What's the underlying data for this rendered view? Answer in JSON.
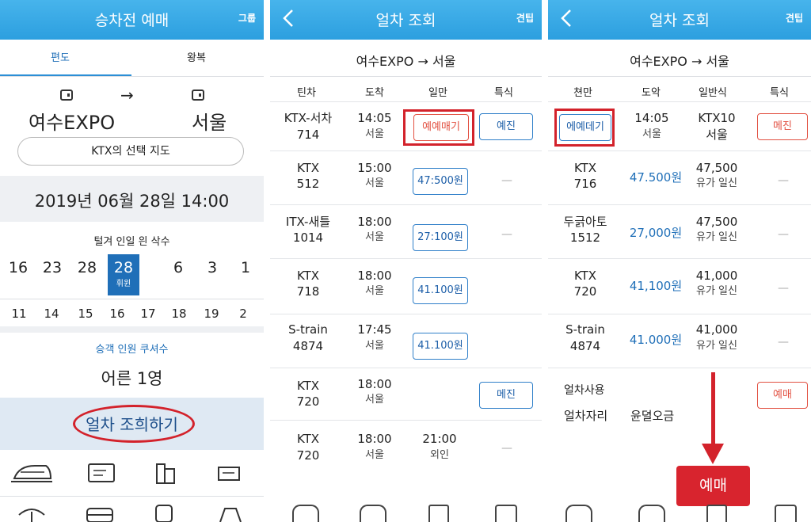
{
  "screen1": {
    "title": "승차전 예매",
    "topright": "그룹",
    "tabs": [
      "편도",
      "왕복"
    ],
    "from_station": "여수EXPO",
    "arrow": "→",
    "to_station": "서울",
    "select_map": "KTX의 선택 지도",
    "datetime": "2019년 06월 28일 14:00",
    "weekday_header": "털겨 인일 읜 삭수",
    "week1": [
      "16",
      "23",
      "28",
      "",
      "6",
      "3",
      "1"
    ],
    "selected_day": "28",
    "selected_sub": "휘윈",
    "week2": [
      "11",
      "14",
      "15",
      "16",
      "17",
      "18",
      "19",
      "2"
    ],
    "passenger_label": "승객 인원 쿠셔수",
    "passenger_value": "어른 1영",
    "search_button": "얼차 조희하기"
  },
  "screen2": {
    "title": "얼차 조회",
    "topright": "견팁",
    "route": "여수EXPO → 서울",
    "headers": [
      "틴차",
      "도착",
      "일만",
      "특식"
    ],
    "rows": [
      {
        "train": "KTX-서차",
        "num": "714",
        "time": "14:05",
        "dest": "서울",
        "general": "예예매기",
        "special": "예진"
      },
      {
        "train": "KTX",
        "num": "512",
        "time": "15:00",
        "dest": "서울",
        "general": "47:500원",
        "special": "—"
      },
      {
        "train": "ITX-새틀",
        "num": "1014",
        "time": "18:00",
        "dest": "서울",
        "general": "27:100원",
        "special": "—"
      },
      {
        "train": "KTX",
        "num": "718",
        "time": "18:00",
        "dest": "서울",
        "general": "41.100원",
        "special": ""
      },
      {
        "train": "S-train",
        "num": "4874",
        "time": "17:45",
        "dest": "서울",
        "general": "41.100원",
        "special": ""
      },
      {
        "train": "KTX",
        "num": "720",
        "time": "18:00",
        "dest": "서울",
        "general": "",
        "special": "메진"
      },
      {
        "train": "KTX",
        "num": "720",
        "time": "18:00",
        "dest": "서울",
        "general": "21:00",
        "general_sub": "외인",
        "special": "—"
      }
    ]
  },
  "screen3": {
    "title": "얼차 조회",
    "topright": "견팁",
    "route": "여수EXPO → 서울",
    "headers": [
      "쳔만",
      "도악",
      "일반식",
      "특식"
    ],
    "rows": [
      {
        "c1": "에예데기",
        "time": "14:05",
        "dest": "서울",
        "c3a": "KTX10",
        "c3b": "서울",
        "special": "메진"
      },
      {
        "c1a": "KTX",
        "c1b": "716",
        "price": "47.500원",
        "c3a": "47,500",
        "c3b": "유가 일신",
        "special": "—"
      },
      {
        "c1a": "두긁아토",
        "c1b": "1512",
        "price": "27,000원",
        "c3a": "47,500",
        "c3b": "유가 일신",
        "special": "—"
      },
      {
        "c1a": "KTX",
        "c1b": "720",
        "price": "41,100원",
        "c3a": "41,000",
        "c3b": "유가 일신",
        "special": "—"
      },
      {
        "c1a": "S-train",
        "c1b": "4874",
        "price": "41.000원",
        "c3a": "41,000",
        "c3b": "유가 일신",
        "special": "—"
      }
    ],
    "info_label": "얼차사용",
    "seat_label": "얼차자리",
    "fare_label": "윤뎔오금",
    "small_button": "예매",
    "book_button": "예매"
  }
}
